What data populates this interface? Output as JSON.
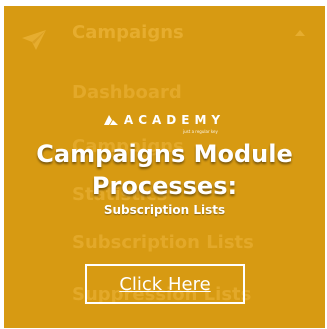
{
  "background_menu": {
    "header": "Campaigns",
    "items": [
      "Dashboard",
      "Campaigns",
      "Statistics",
      "Subscription Lists",
      "Suppression Lists"
    ]
  },
  "promo": {
    "brand": "ACADEMY",
    "brand_tagline": "just a regular key",
    "title_line1": "Campaigns Module",
    "title_line2": "Processes:",
    "subtitle": "Subscription Lists",
    "cta_label": "Click Here"
  },
  "colors": {
    "panel": "#d79a12",
    "faded_text": "#e3a92a",
    "text": "#ffffff"
  },
  "icons": {
    "nav": "paper-plane-icon",
    "expand": "caret-up-icon",
    "brand": "academy-logo-icon"
  }
}
